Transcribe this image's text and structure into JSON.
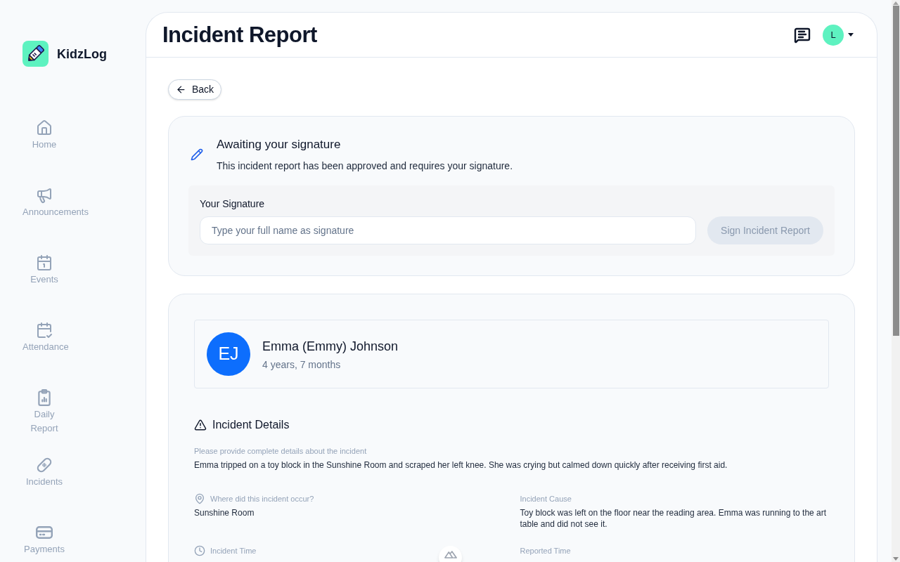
{
  "sidebar": {
    "logo": "KidzLog",
    "items": [
      {
        "label": "Home"
      },
      {
        "label": "Announcements"
      },
      {
        "label": "Events"
      },
      {
        "label": "Attendance"
      },
      {
        "label": "Daily Report"
      },
      {
        "label": "Incidents"
      },
      {
        "label": "Payments"
      }
    ]
  },
  "header": {
    "title": "Incident Report",
    "user_initial": "L"
  },
  "back_button": "Back",
  "signature": {
    "title": "Awaiting your signature",
    "message": "This incident report has been approved and requires your signature.",
    "field_label": "Your Signature",
    "placeholder": "Type your full name as signature",
    "button": {
      "label": "Sign Incident Report",
      "disabled": true
    }
  },
  "child": {
    "initials": "EJ",
    "name": "Emma (Emmy) Johnson",
    "age": "4 years, 7 months"
  },
  "incident_details": {
    "title": "Incident Details",
    "description_label": "Please provide complete details about the incident",
    "description": "Emma tripped on a toy block in the Sunshine Room and scraped her left knee. She was crying but calmed down quickly after receiving first aid.",
    "fields": [
      {
        "label": "Where did this incident occur?",
        "value": "Sunshine Room"
      },
      {
        "label": "Incident Cause",
        "value": "Toy block was left on the floor near the reading area. Emma was running to the art table and did not see it."
      },
      {
        "label": "Incident Time"
      },
      {
        "label": "Reported Time"
      }
    ]
  }
}
